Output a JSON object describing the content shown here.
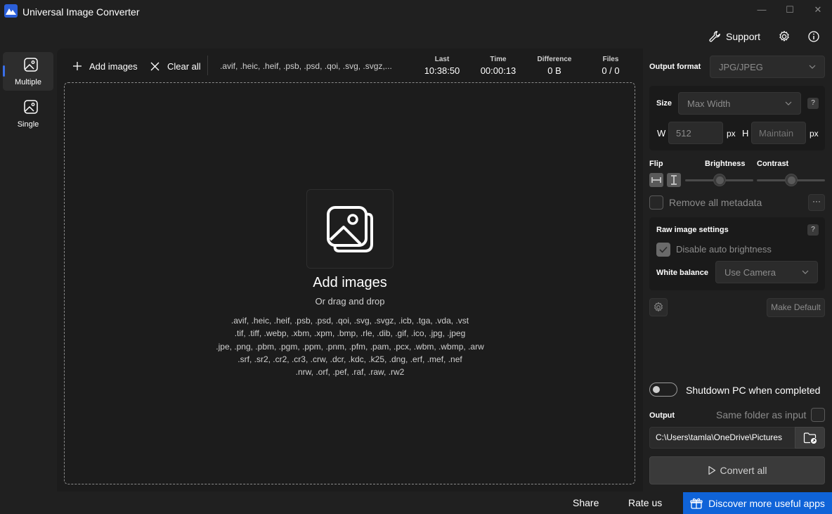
{
  "window": {
    "title": "Universal Image Converter",
    "controls": {
      "minimize": "—",
      "maximize": "☐",
      "close": "✕"
    }
  },
  "top_toolbar": {
    "support_label": "Support",
    "icons": [
      "wrench-icon",
      "gear-icon",
      "info-icon"
    ]
  },
  "nav": {
    "items": [
      {
        "label": "Multiple",
        "selected": true
      },
      {
        "label": "Single",
        "selected": false
      }
    ]
  },
  "main": {
    "add_images_label": "Add images",
    "clear_all_label": "Clear all",
    "formats_short": ".avif, .heic, .heif, .psb, .psd, .qoi, .svg, .svgz,...",
    "stats": {
      "last": {
        "label": "Last",
        "value": "10:38:50"
      },
      "time": {
        "label": "Time",
        "value": "00:00:13"
      },
      "difference": {
        "label": "Difference",
        "value": "0 B"
      },
      "files": {
        "label": "Files",
        "value": "0 / 0"
      }
    },
    "drop": {
      "title": "Add images",
      "subtitle": "Or drag and drop",
      "formats": [
        ".avif, .heic, .heif, .psb, .psd, .qoi, .svg, .svgz, .icb, .tga, .vda, .vst",
        ".tif, .tiff, .webp, .xbm, .xpm, .bmp, .rle, .dib, .gif, .ico, .jpg, .jpeg",
        ".jpe, .png, .pbm, .pgm, .ppm, .pnm, .pfm, .pam, .pcx, .wbm, .wbmp, .arw",
        ".srf, .sr2, .cr2, .cr3, .crw, .dcr, .kdc, .k25, .dng, .erf, .mef, .nef",
        ".nrw, .orf, .pef, .raf, .raw, .rw2"
      ]
    }
  },
  "settings": {
    "output_format_label": "Output format",
    "output_format_value": "JPG/JPEG",
    "size_label": "Size",
    "size_value": "Max Width",
    "help_glyph": "?",
    "w_label": "W",
    "w_value": "512",
    "h_label": "H",
    "h_placeholder": "Maintain",
    "unit": "px",
    "flip_label": "Flip",
    "brightness_label": "Brightness",
    "brightness_level": 0.5,
    "contrast_label": "Contrast",
    "contrast_level": 0.5,
    "remove_metadata_label": "Remove all metadata",
    "remove_metadata_checked": false,
    "more_glyph": "···",
    "raw_label": "Raw image settings",
    "auto_brightness_label": "Disable auto brightness",
    "auto_brightness_checked": true,
    "white_balance_label": "White balance",
    "white_balance_value": "Use Camera",
    "make_default_label": "Make Default",
    "shutdown_label": "Shutdown PC when completed",
    "shutdown_on": false,
    "output_label": "Output",
    "same_folder_label": "Same folder as input",
    "same_folder_checked": false,
    "output_path": "C:\\Users\\tamla\\OneDrive\\Pictures",
    "convert_label": "Convert all"
  },
  "bottom": {
    "share_label": "Share",
    "rate_label": "Rate us",
    "discover_label": "Discover more useful apps"
  },
  "colors": {
    "background": "#202020",
    "panel": "#1c1c1c",
    "accent": "#0f63d8",
    "nav_indicator": "#3a6fe8"
  }
}
